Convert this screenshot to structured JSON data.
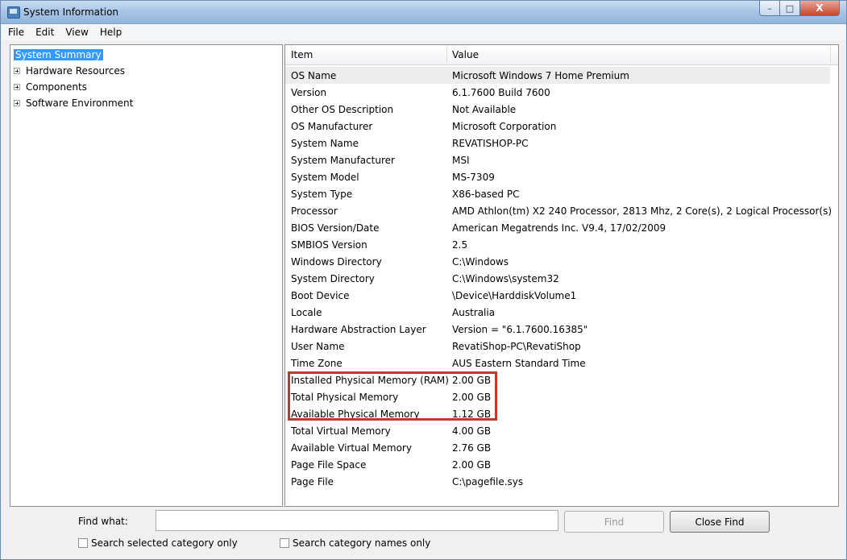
{
  "window": {
    "title": "System Information",
    "controls": {
      "minimize": "–",
      "maximize": "□",
      "close": "X"
    }
  },
  "menu": {
    "items": [
      "File",
      "Edit",
      "View",
      "Help"
    ]
  },
  "tree": {
    "items": [
      {
        "label": "System Summary",
        "selected": true,
        "expandable": false
      },
      {
        "label": "Hardware Resources",
        "selected": false,
        "expandable": true
      },
      {
        "label": "Components",
        "selected": false,
        "expandable": true
      },
      {
        "label": "Software Environment",
        "selected": false,
        "expandable": true
      }
    ]
  },
  "table": {
    "columns": [
      "Item",
      "Value"
    ],
    "rows": [
      {
        "item": "OS Name",
        "value": "Microsoft Windows 7 Home Premium"
      },
      {
        "item": "Version",
        "value": "6.1.7600 Build 7600"
      },
      {
        "item": "Other OS Description",
        "value": "Not Available"
      },
      {
        "item": "OS Manufacturer",
        "value": "Microsoft Corporation"
      },
      {
        "item": "System Name",
        "value": "REVATISHOP-PC"
      },
      {
        "item": "System Manufacturer",
        "value": "MSI"
      },
      {
        "item": "System Model",
        "value": "MS-7309"
      },
      {
        "item": "System Type",
        "value": "X86-based PC"
      },
      {
        "item": "Processor",
        "value": "AMD Athlon(tm) X2 240 Processor, 2813 Mhz, 2 Core(s), 2 Logical Processor(s)"
      },
      {
        "item": "BIOS Version/Date",
        "value": "American Megatrends Inc. V9.4, 17/02/2009"
      },
      {
        "item": "SMBIOS Version",
        "value": "2.5"
      },
      {
        "item": "Windows Directory",
        "value": "C:\\Windows"
      },
      {
        "item": "System Directory",
        "value": "C:\\Windows\\system32"
      },
      {
        "item": "Boot Device",
        "value": "\\Device\\HarddiskVolume1"
      },
      {
        "item": "Locale",
        "value": "Australia"
      },
      {
        "item": "Hardware Abstraction Layer",
        "value": "Version = \"6.1.7600.16385\""
      },
      {
        "item": "User Name",
        "value": "RevatiShop-PC\\RevatiShop"
      },
      {
        "item": "Time Zone",
        "value": "AUS Eastern Standard Time"
      },
      {
        "item": "Installed Physical Memory (RAM)",
        "value": "2.00 GB"
      },
      {
        "item": "Total Physical Memory",
        "value": "2.00 GB"
      },
      {
        "item": "Available Physical Memory",
        "value": "1.12 GB"
      },
      {
        "item": "Total Virtual Memory",
        "value": "4.00 GB"
      },
      {
        "item": "Available Virtual Memory",
        "value": "2.76 GB"
      },
      {
        "item": "Page File Space",
        "value": "2.00 GB"
      },
      {
        "item": "Page File",
        "value": "C:\\pagefile.sys"
      }
    ]
  },
  "find": {
    "label": "Find what:",
    "value": "",
    "find_button": "Find",
    "close_button": "Close Find",
    "option_selected_category": "Search selected category only",
    "option_category_names": "Search category names only"
  },
  "colors": {
    "selection": "#3399ff",
    "annotation": "#c0392b"
  }
}
